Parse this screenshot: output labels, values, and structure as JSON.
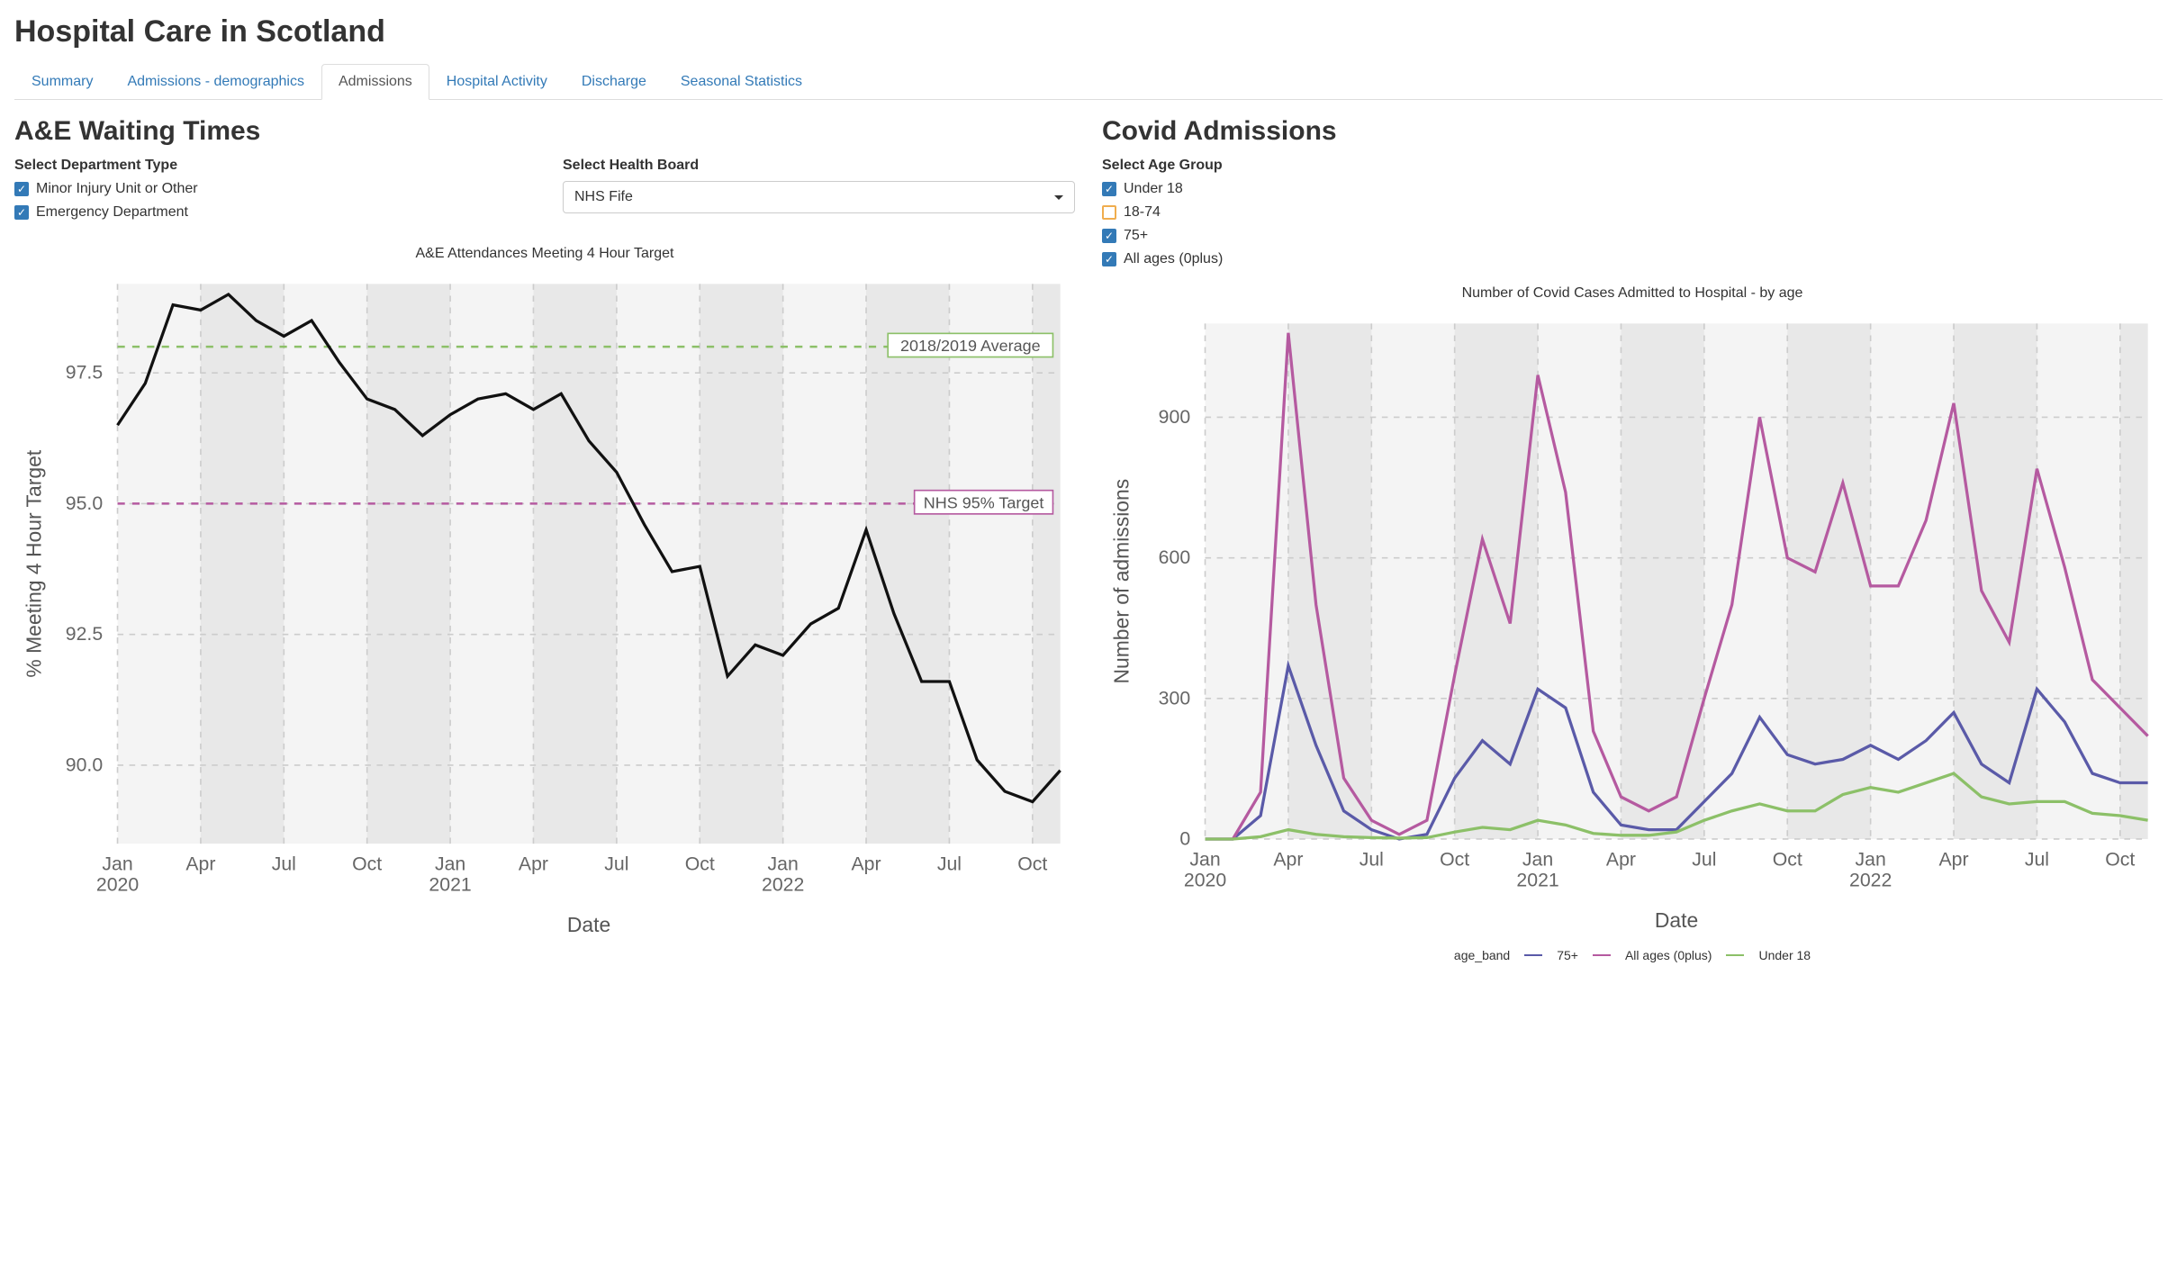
{
  "page_title": "Hospital Care in Scotland",
  "tabs": [
    {
      "label": "Summary",
      "active": false
    },
    {
      "label": "Admissions - demographics",
      "active": false
    },
    {
      "label": "Admissions",
      "active": true
    },
    {
      "label": "Hospital Activity",
      "active": false
    },
    {
      "label": "Discharge",
      "active": false
    },
    {
      "label": "Seasonal Statistics",
      "active": false
    }
  ],
  "left_panel": {
    "heading": "A&E Waiting Times",
    "dept_label": "Select Department Type",
    "dept_options": [
      {
        "label": "Minor Injury Unit or Other",
        "checked": true
      },
      {
        "label": "Emergency Department",
        "checked": true
      }
    ],
    "board_label": "Select Health Board",
    "board_value": "NHS Fife",
    "chart_title": "A&E Attendances Meeting 4 Hour Target",
    "xlabel": "Date",
    "ylabel": "% Meeting 4 Hour Target",
    "ref1": "2018/2019 Average",
    "ref2": "NHS 95% Target"
  },
  "right_panel": {
    "heading": "Covid Admissions",
    "age_label": "Select Age Group",
    "age_options": [
      {
        "label": "Under 18",
        "checked": true
      },
      {
        "label": "18-74",
        "checked": false
      },
      {
        "label": "75+",
        "checked": true
      },
      {
        "label": "All ages (0plus)",
        "checked": true
      }
    ],
    "chart_title": "Number of Covid Cases Admitted to Hospital - by age",
    "xlabel": "Date",
    "ylabel": "Number of admissions",
    "legend_title": "age_band",
    "legend_items": [
      "75+",
      "All ages (0plus)",
      "Under 18"
    ]
  },
  "colors": {
    "link": "#337ab7",
    "75plus": "#5a5aa8",
    "allages": "#b55aa0",
    "under18": "#8cc068",
    "refgreen": "#8cc068",
    "refmagenta": "#b55aa0",
    "line_main": "#111"
  },
  "chart_data": [
    {
      "id": "ae_waiting",
      "type": "line",
      "title": "A&E Attendances Meeting 4 Hour Target",
      "xlabel": "Date",
      "ylabel": "% Meeting 4 Hour Target",
      "ylim": [
        88.5,
        99.2
      ],
      "x": [
        "Jan 2020",
        "Feb 2020",
        "Mar 2020",
        "Apr 2020",
        "May 2020",
        "Jun 2020",
        "Jul 2020",
        "Aug 2020",
        "Sep 2020",
        "Oct 2020",
        "Nov 2020",
        "Dec 2020",
        "Jan 2021",
        "Feb 2021",
        "Mar 2021",
        "Apr 2021",
        "May 2021",
        "Jun 2021",
        "Jul 2021",
        "Aug 2021",
        "Sep 2021",
        "Oct 2021",
        "Nov 2021",
        "Dec 2021",
        "Jan 2022",
        "Feb 2022",
        "Mar 2022",
        "Apr 2022",
        "May 2022",
        "Jun 2022",
        "Jul 2022",
        "Aug 2022",
        "Sep 2022",
        "Oct 2022",
        "Nov 2022"
      ],
      "x_tick_labels": [
        "Jan\n2020",
        "Apr",
        "Jul",
        "Oct",
        "Jan\n2021",
        "Apr",
        "Jul",
        "Oct",
        "Jan\n2022",
        "Apr",
        "Jul",
        "Oct"
      ],
      "y_tick_labels": [
        "90.0",
        "92.5",
        "95.0",
        "97.5"
      ],
      "reference_lines": [
        {
          "label": "2018/2019 Average",
          "value": 98.0,
          "color": "#8cc068"
        },
        {
          "label": "NHS 95% Target",
          "value": 95.0,
          "color": "#b55aa0"
        }
      ],
      "series": [
        {
          "name": "% meeting target",
          "color": "#111",
          "values": [
            96.5,
            97.3,
            98.8,
            98.7,
            99.0,
            98.5,
            98.2,
            98.5,
            97.7,
            97.0,
            96.8,
            96.3,
            96.7,
            97.0,
            97.1,
            96.8,
            97.1,
            96.2,
            95.6,
            94.6,
            93.7,
            93.8,
            91.7,
            92.3,
            92.1,
            92.7,
            93.0,
            94.5,
            92.9,
            91.6,
            91.6,
            90.1,
            89.5,
            89.3,
            89.9
          ]
        }
      ]
    },
    {
      "id": "covid_admissions",
      "type": "line",
      "title": "Number of Covid Cases Admitted to Hospital - by age",
      "xlabel": "Date",
      "ylabel": "Number of admissions",
      "ylim": [
        0,
        1100
      ],
      "x": [
        "Jan 2020",
        "Feb 2020",
        "Mar 2020",
        "Apr 2020",
        "May 2020",
        "Jun 2020",
        "Jul 2020",
        "Aug 2020",
        "Sep 2020",
        "Oct 2020",
        "Nov 2020",
        "Dec 2020",
        "Jan 2021",
        "Feb 2021",
        "Mar 2021",
        "Apr 2021",
        "May 2021",
        "Jun 2021",
        "Jul 2021",
        "Aug 2021",
        "Sep 2021",
        "Oct 2021",
        "Nov 2021",
        "Dec 2021",
        "Jan 2022",
        "Feb 2022",
        "Mar 2022",
        "Apr 2022",
        "May 2022",
        "Jun 2022",
        "Jul 2022",
        "Aug 2022",
        "Sep 2022",
        "Oct 2022",
        "Nov 2022"
      ],
      "x_tick_labels": [
        "Jan\n2020",
        "Apr",
        "Jul",
        "Oct",
        "Jan\n2021",
        "Apr",
        "Jul",
        "Oct",
        "Jan\n2022",
        "Apr",
        "Jul",
        "Oct"
      ],
      "y_tick_labels": [
        "0",
        "300",
        "600",
        "900"
      ],
      "legend_title": "age_band",
      "series": [
        {
          "name": "75+",
          "color": "#5a5aa8",
          "values": [
            0,
            0,
            50,
            370,
            200,
            60,
            20,
            0,
            10,
            130,
            210,
            160,
            320,
            280,
            100,
            30,
            20,
            20,
            80,
            140,
            260,
            180,
            160,
            170,
            200,
            170,
            210,
            270,
            160,
            120,
            320,
            250,
            140,
            120,
            120
          ]
        },
        {
          "name": "All ages (0plus)",
          "color": "#b55aa0",
          "values": [
            0,
            0,
            100,
            1080,
            500,
            130,
            40,
            10,
            40,
            350,
            640,
            460,
            990,
            740,
            230,
            90,
            60,
            90,
            300,
            500,
            900,
            600,
            570,
            760,
            540,
            540,
            680,
            930,
            530,
            420,
            790,
            580,
            340,
            280,
            220
          ]
        },
        {
          "name": "Under 18",
          "color": "#8cc068",
          "values": [
            0,
            0,
            5,
            20,
            10,
            5,
            3,
            2,
            3,
            15,
            25,
            20,
            40,
            30,
            12,
            8,
            8,
            15,
            40,
            60,
            75,
            60,
            60,
            95,
            110,
            100,
            120,
            140,
            90,
            75,
            80,
            80,
            55,
            50,
            40
          ]
        }
      ]
    }
  ]
}
